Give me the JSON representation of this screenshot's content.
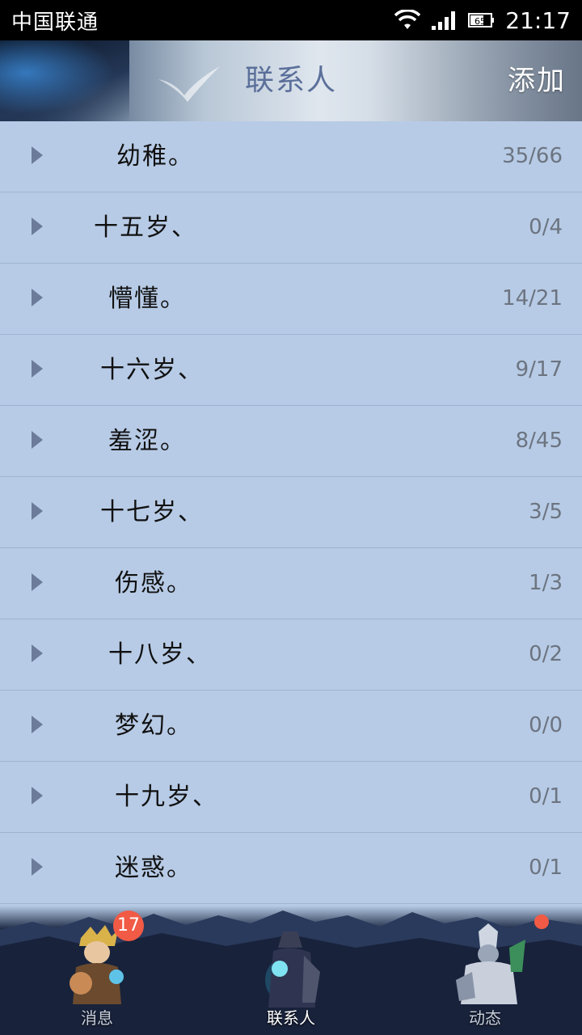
{
  "status_bar": {
    "carrier": "中国联通",
    "battery": "65",
    "time": "21:17",
    "icons": [
      "wifi-icon",
      "signal-icon",
      "battery-icon"
    ]
  },
  "header": {
    "title": "联系人",
    "add_label": "添加"
  },
  "groups": [
    {
      "name": "幼稚。",
      "count": "35/66"
    },
    {
      "name": "十五岁、",
      "count": "0/4"
    },
    {
      "name": "懵懂。",
      "count": "14/21"
    },
    {
      "name": "十六岁、",
      "count": "9/17"
    },
    {
      "name": "羞涩。",
      "count": "8/45"
    },
    {
      "name": "十七岁、",
      "count": "3/5"
    },
    {
      "name": "伤感。",
      "count": "1/3"
    },
    {
      "name": "十八岁、",
      "count": "0/2"
    },
    {
      "name": "梦幻。",
      "count": "0/0"
    },
    {
      "name": "十九岁、",
      "count": "0/1"
    },
    {
      "name": "迷惑。",
      "count": "0/1"
    }
  ],
  "bottom_nav": {
    "items": [
      {
        "label": "消息",
        "badge": "17"
      },
      {
        "label": "联系人"
      },
      {
        "label": "动态"
      }
    ],
    "colors": {
      "badge": "#f15a45"
    }
  },
  "colors": {
    "list_background": "#b7cbe6",
    "title": "#5b6f9a"
  }
}
